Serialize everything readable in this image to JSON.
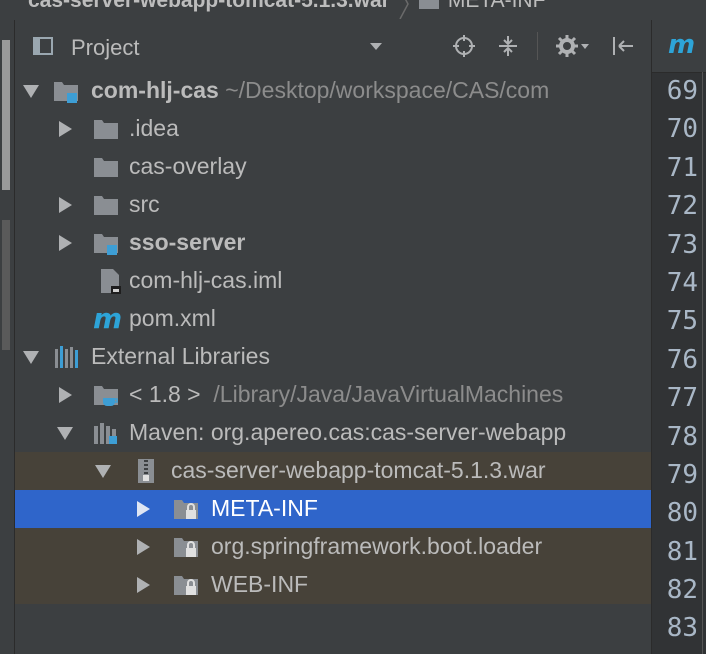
{
  "breadcrumb": {
    "items": [
      "cas-server-webapp-tomcat-5.1.3.war",
      "META-INF"
    ]
  },
  "panel": {
    "title": "Project",
    "icons": [
      "project-view-icon",
      "chevron-down-icon",
      "locate-icon",
      "collapse-all-icon",
      "gear-icon",
      "hide-panel-icon"
    ]
  },
  "tree": {
    "root": {
      "name": "com-hlj-cas",
      "path": "~/Desktop/workspace/CAS/com"
    },
    "idea": ".idea",
    "cas_overlay": "cas-overlay",
    "src": "src",
    "sso_server": "sso-server",
    "iml": "com-hlj-cas.iml",
    "pom": "pom.xml",
    "external_libraries": "External Libraries",
    "jdk": {
      "version": "< 1.8 >",
      "path": "/Library/Java/JavaVirtualMachines"
    },
    "maven": "Maven: org.apereo.cas:cas-server-webapp",
    "war": "cas-server-webapp-tomcat-5.1.3.war",
    "meta_inf": "META-INF",
    "boot_loader": "org.springframework.boot.loader",
    "web_inf": "WEB-INF"
  },
  "editor": {
    "tab_icon": "m",
    "line_numbers": [
      "69",
      "70",
      "71",
      "72",
      "73",
      "74",
      "75",
      "76",
      "77",
      "78",
      "79",
      "80",
      "81",
      "82",
      "83"
    ]
  },
  "colors": {
    "background": "#3c3f41",
    "selection": "#2f65ca",
    "highlight": "#474239",
    "folder": "#8a8e93",
    "module_badge": "#3d9ed5",
    "maven_m": "#2da4d8"
  }
}
